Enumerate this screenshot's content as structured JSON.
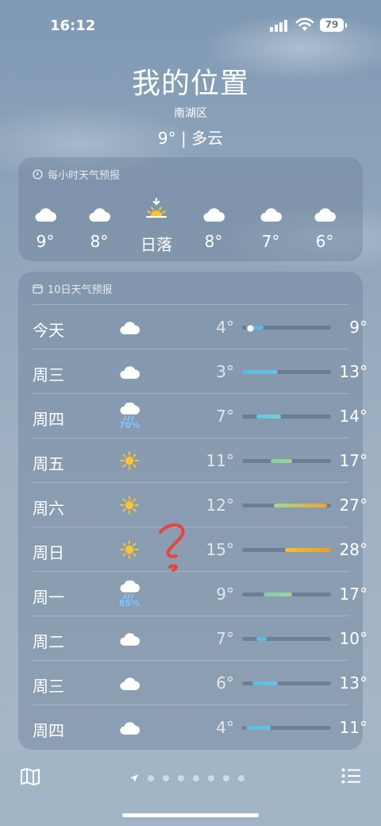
{
  "status": {
    "time": "16:12",
    "battery": "79"
  },
  "location": {
    "title": "我的位置",
    "district": "南湖区",
    "summary": "9° | 多云"
  },
  "hourly": {
    "title": "每小时天气预报",
    "items": [
      {
        "icon": "cloud-icon",
        "value": "9°"
      },
      {
        "icon": "cloud-icon",
        "value": "8°"
      },
      {
        "icon": "sunset-icon",
        "value": "日落"
      },
      {
        "icon": "cloud-icon",
        "value": "8°"
      },
      {
        "icon": "cloud-icon",
        "value": "7°"
      },
      {
        "icon": "cloud-icon",
        "value": "6°"
      }
    ]
  },
  "daily": {
    "title": "10日天气预报",
    "range": [
      3,
      28
    ],
    "rows": [
      {
        "day": "今天",
        "icon": "cloud-icon",
        "low": "4°",
        "high": "9°",
        "lo": 4,
        "hi": 9,
        "current": 5,
        "colors": [
          "#5bbbe0",
          "#5bbbe0"
        ]
      },
      {
        "day": "周三",
        "icon": "cloud-icon",
        "low": "3°",
        "high": "13°",
        "lo": 3,
        "hi": 13,
        "colors": [
          "#5bbbe0",
          "#66c2e6"
        ]
      },
      {
        "day": "周四",
        "icon": "rain-icon",
        "prob": "70%",
        "low": "7°",
        "high": "14°",
        "lo": 7,
        "hi": 14,
        "colors": [
          "#66c8d9",
          "#6dcfd6"
        ]
      },
      {
        "day": "周五",
        "icon": "sun-icon",
        "low": "11°",
        "high": "17°",
        "lo": 11,
        "hi": 17,
        "colors": [
          "#80d0a0",
          "#9dd68c"
        ]
      },
      {
        "day": "周六",
        "icon": "sun-icon",
        "low": "12°",
        "high": "27°",
        "lo": 12,
        "hi": 27,
        "colors": [
          "#a8d68a",
          "#f2a230"
        ]
      },
      {
        "day": "周日",
        "icon": "sun-icon",
        "low": "15°",
        "high": "28°",
        "lo": 15,
        "hi": 28,
        "colors": [
          "#f0c030",
          "#f09a28"
        ]
      },
      {
        "day": "周一",
        "icon": "rain-icon",
        "prob": "85%",
        "low": "9°",
        "high": "17°",
        "lo": 9,
        "hi": 17,
        "colors": [
          "#7ccfb4",
          "#9dd68c"
        ]
      },
      {
        "day": "周二",
        "icon": "cloud-icon",
        "low": "7°",
        "high": "10°",
        "lo": 7,
        "hi": 10,
        "colors": [
          "#5bbbe0",
          "#5bbbe0"
        ]
      },
      {
        "day": "周三",
        "icon": "cloud-icon",
        "low": "6°",
        "high": "13°",
        "lo": 6,
        "hi": 13,
        "colors": [
          "#5bbbe0",
          "#66c2e6"
        ]
      },
      {
        "day": "周四",
        "icon": "cloud-icon",
        "low": "4°",
        "high": "11°",
        "lo": 4,
        "hi": 11,
        "colors": [
          "#5bbbe0",
          "#66c2e6"
        ]
      }
    ]
  },
  "colors": {
    "sun": "#f7c531",
    "rain": "#7cc9ff"
  }
}
